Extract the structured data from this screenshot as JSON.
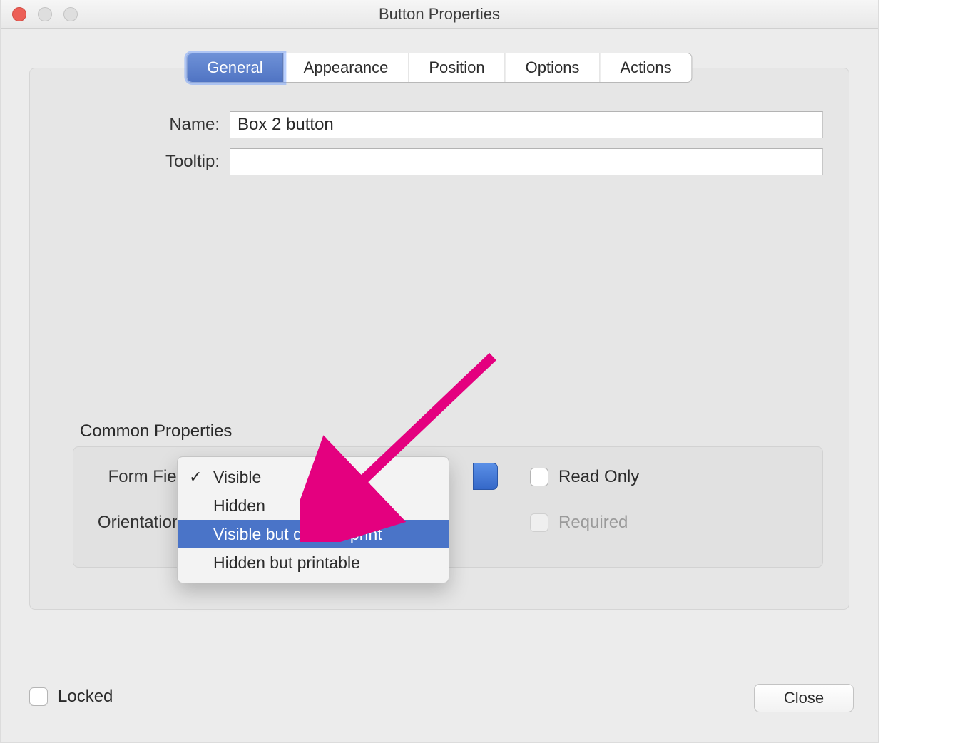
{
  "window": {
    "title": "Button Properties"
  },
  "tabs": {
    "general": "General",
    "appearance": "Appearance",
    "position": "Position",
    "options": "Options",
    "actions": "Actions"
  },
  "fields": {
    "name_label": "Name:",
    "name_value": "Box 2 button",
    "tooltip_label": "Tooltip:",
    "tooltip_value": ""
  },
  "common": {
    "section_label": "Common Properties",
    "formfield_label": "Form Field:",
    "orientation_label": "Orientation:",
    "readonly_label": "Read Only",
    "required_label": "Required"
  },
  "formfield_options": {
    "visible": "Visible",
    "hidden": "Hidden",
    "visible_no_print": "Visible but doesn't print",
    "hidden_printable": "Hidden but printable"
  },
  "footer": {
    "locked_label": "Locked",
    "close_label": "Close"
  },
  "annotation": {
    "color": "#e4007f"
  }
}
